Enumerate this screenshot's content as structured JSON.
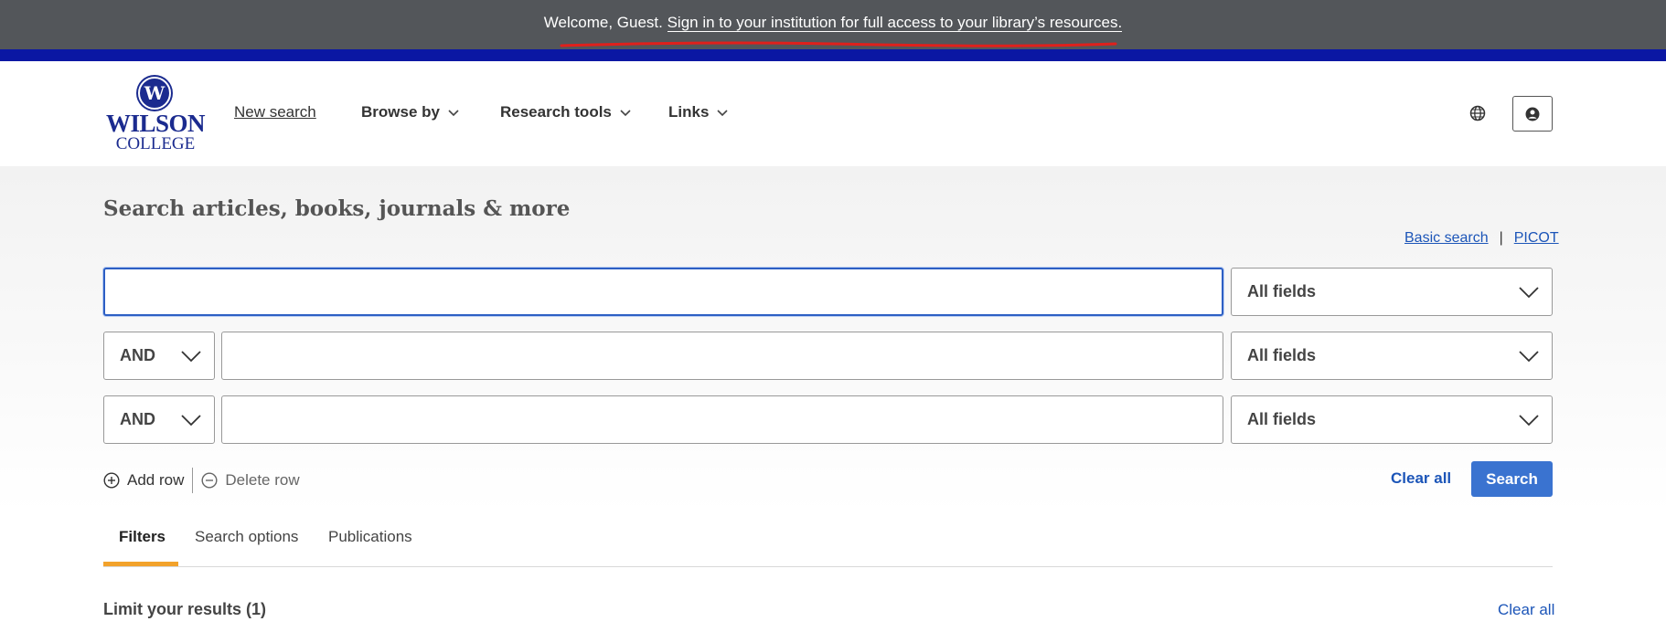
{
  "banner": {
    "welcome": "Welcome, Guest.",
    "signin_link": "Sign in to your institution for full access to your library’s resources.",
    "bg_color": "#53565a",
    "accent_bar_color": "#0a17a3",
    "annotation_color": "#e0201c"
  },
  "logo": {
    "seal_letter": "W",
    "line1": "WILSON",
    "line2": "COLLEGE",
    "brand_color": "#1b2b8f"
  },
  "nav": {
    "new_search": "New search",
    "browse_by": "Browse by",
    "research_tools": "Research tools",
    "links": "Links"
  },
  "header_icons": {
    "language": "globe-icon",
    "account": "user-circle-icon"
  },
  "main": {
    "title": "Search articles, books, journals & more",
    "basic_search": "Basic search",
    "separator": "|",
    "picot": "PICOT",
    "rows": [
      {
        "operator": null,
        "query": "",
        "field": "All fields"
      },
      {
        "operator": "AND",
        "query": "",
        "field": "All fields"
      },
      {
        "operator": "AND",
        "query": "",
        "field": "All fields"
      }
    ],
    "add_row": "Add row",
    "delete_row": "Delete row",
    "clear_all": "Clear all",
    "search_button": "Search",
    "link_color": "#1c55b8",
    "button_color": "#3a73d0"
  },
  "tabs": [
    {
      "label": "Filters",
      "active": true
    },
    {
      "label": "Search options",
      "active": false
    },
    {
      "label": "Publications",
      "active": false
    }
  ],
  "tab_accent_color": "#f2a22b",
  "limit": {
    "title": "Limit your results (1)",
    "clear_all": "Clear all"
  }
}
